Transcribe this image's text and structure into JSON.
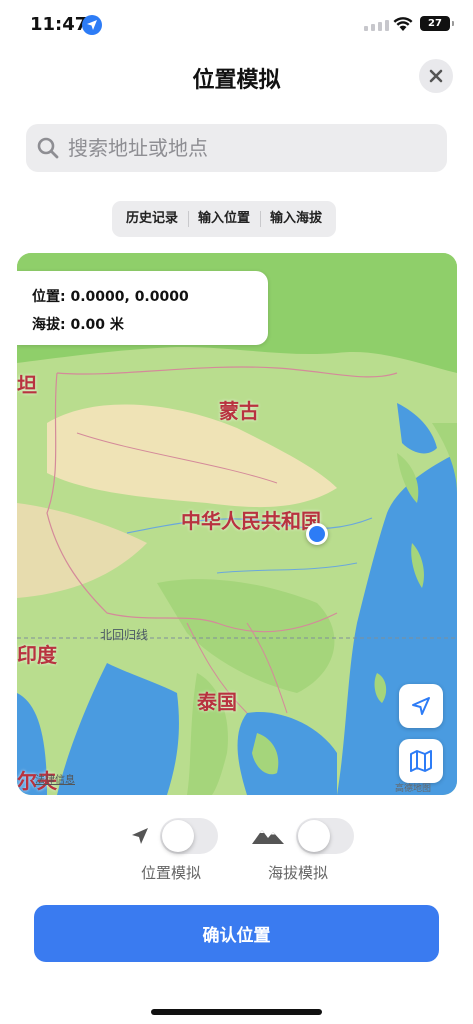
{
  "status_bar": {
    "time": "11:47",
    "battery": "27"
  },
  "header": {
    "title": "位置模拟"
  },
  "search": {
    "placeholder": "搜索地址或地点"
  },
  "segments": [
    "历史记录",
    "输入位置",
    "输入海拔"
  ],
  "map": {
    "info_position": "位置: 0.0000, 0.0000",
    "info_altitude": "海拔: 0.00 米",
    "labels": {
      "mongolia": "蒙古",
      "china": "中华人民共和国",
      "india": "印度",
      "thailand": "泰国",
      "tropic": "北回归线",
      "edge_left": "坦",
      "edge_bottom": "尔夫"
    },
    "legal": "法律信息",
    "attribution": "高德地图",
    "colors": {
      "land": "#b9dd8e",
      "desert": "#efe3b6",
      "ocean": "#4a9be0",
      "label": "#b8323f"
    }
  },
  "toggles": {
    "position_label": "位置模拟",
    "altitude_label": "海拔模拟",
    "position_on": false,
    "altitude_on": false
  },
  "confirm": {
    "label": "确认位置"
  },
  "colors": {
    "accent": "#3a7bf0"
  }
}
